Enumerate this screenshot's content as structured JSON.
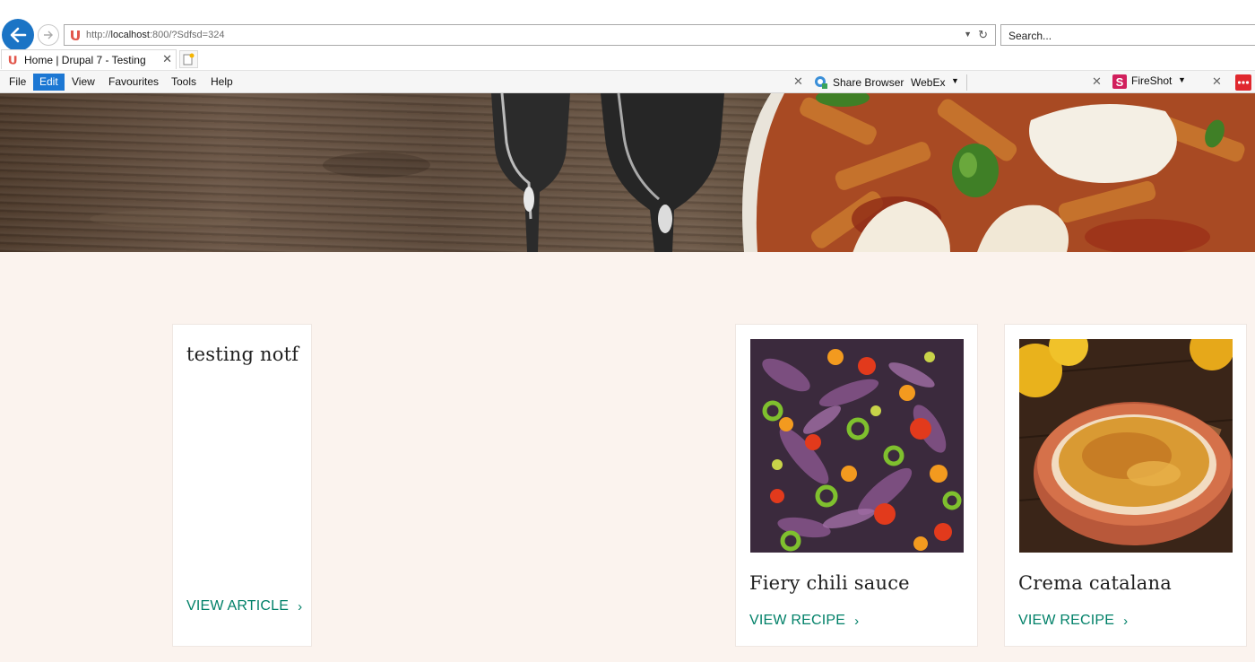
{
  "browser": {
    "url_prefix": "http://",
    "url_host": "localhost",
    "url_rest": ":800/?Sdfsd=324",
    "search_placeholder": "Search...",
    "tab_title": "Home | Drupal 7 - Testing",
    "menu": [
      "File",
      "Edit",
      "View",
      "Favourites",
      "Tools",
      "Help"
    ],
    "toolbar": {
      "share_browser": "Share Browser",
      "webex": "WebEx",
      "fireshot": "FireShot"
    }
  },
  "cards": [
    {
      "type": "article",
      "title": "testing notf",
      "link": "VIEW ARTICLE"
    },
    {
      "type": "recipe",
      "title": "Fiery chili sauce",
      "link": "VIEW RECIPE",
      "image": "chili-salad"
    },
    {
      "type": "recipe",
      "title": "Crema catalana",
      "link": "VIEW RECIPE",
      "image": "crema-catalana"
    }
  ],
  "colors": {
    "page_bg": "#fbf3ee",
    "link": "#008068",
    "browser_accent": "#1b74c5"
  }
}
